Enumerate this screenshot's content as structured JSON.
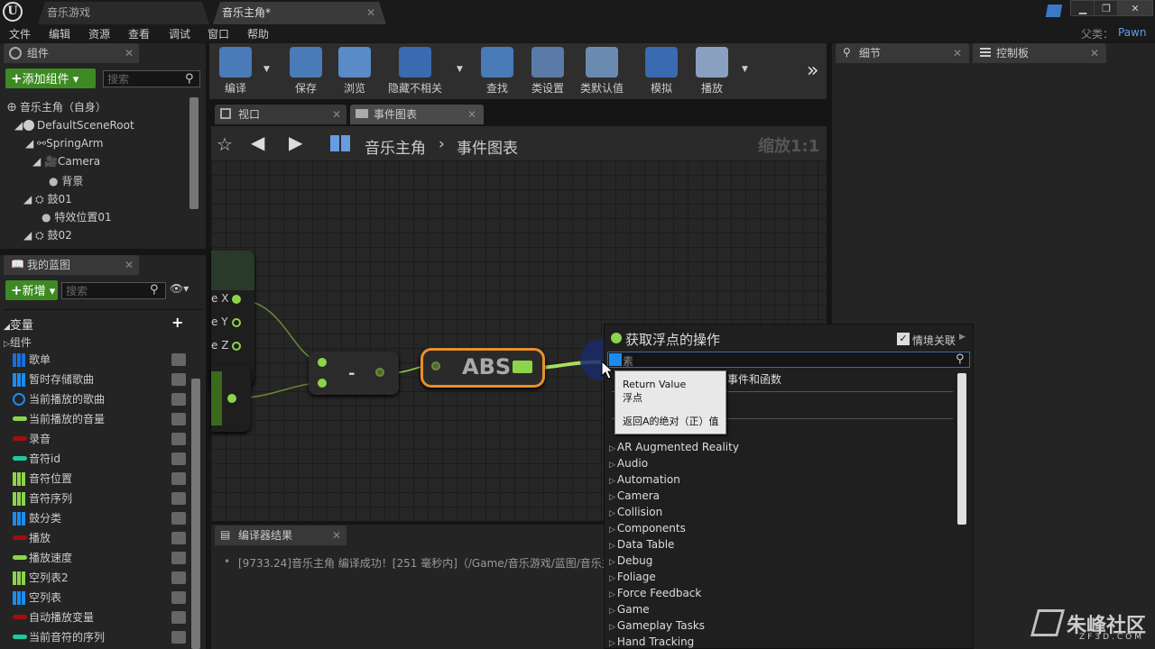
{
  "titlebar": {
    "tabs": [
      {
        "label": "音乐游戏"
      },
      {
        "label": "音乐主角*"
      }
    ],
    "parent_label": "父类：",
    "parent_value": "Pawn"
  },
  "menu": [
    "文件",
    "编辑",
    "资源",
    "查看",
    "调试",
    "窗口",
    "帮助"
  ],
  "components_panel": {
    "tab": "组件",
    "add_button": "添加组件",
    "search_placeholder": "搜索",
    "root": "音乐主角（自身）",
    "tree": [
      "DefaultSceneRoot",
      "SpringArm",
      "Camera",
      "背景",
      "鼓01",
      "特效位置01",
      "鼓02"
    ]
  },
  "blueprint_panel": {
    "tab": "我的蓝图",
    "new_button": "新增",
    "search_placeholder": "搜索",
    "variables_header": "变量",
    "components_header": "组件",
    "variables": [
      {
        "name": "歌单",
        "color": "#1a6fd8",
        "shape": "sq"
      },
      {
        "name": "暂时存储歌曲",
        "color": "#1a8cf0",
        "shape": "sq"
      },
      {
        "name": "当前播放的歌曲",
        "color": "#1a8cf0",
        "shape": "ring"
      },
      {
        "name": "当前播放的音量",
        "color": "#8cd44a",
        "shape": "pill"
      },
      {
        "name": "录音",
        "color": "#a01010",
        "shape": "pill"
      },
      {
        "name": "音符id",
        "color": "#20c8a0",
        "shape": "pill"
      },
      {
        "name": "音符位置",
        "color": "#8cd44a",
        "shape": "sq"
      },
      {
        "name": "音符序列",
        "color": "#8cd44a",
        "shape": "sq"
      },
      {
        "name": "鼓分类",
        "color": "#1a8cf0",
        "shape": "sq"
      },
      {
        "name": "播放",
        "color": "#a01010",
        "shape": "pill"
      },
      {
        "name": "播放速度",
        "color": "#8cd44a",
        "shape": "pill"
      },
      {
        "name": "空列表2",
        "color": "#8cd44a",
        "shape": "sq"
      },
      {
        "name": "空列表",
        "color": "#1a8cf0",
        "shape": "sq"
      },
      {
        "name": "自动播放变量",
        "color": "#a01010",
        "shape": "pill"
      },
      {
        "name": "当前音符的序列",
        "color": "#20c8a0",
        "shape": "pill"
      }
    ]
  },
  "toolbar": [
    {
      "label": "编译",
      "icon": "compile-icon"
    },
    {
      "label": "保存",
      "icon": "save-icon"
    },
    {
      "label": "浏览",
      "icon": "browse-icon"
    },
    {
      "label": "隐藏不相关",
      "icon": "hide-unrelated-icon"
    },
    {
      "label": "查找",
      "icon": "find-icon"
    },
    {
      "label": "类设置",
      "icon": "class-settings-icon"
    },
    {
      "label": "类默认值",
      "icon": "class-defaults-icon"
    },
    {
      "label": "模拟",
      "icon": "simulate-icon"
    },
    {
      "label": "播放",
      "icon": "play-icon"
    }
  ],
  "editor_tabs": [
    "视口",
    "事件图表"
  ],
  "breadcrumb": {
    "root": "音乐主角",
    "sep": "›",
    "current": "事件图表",
    "zoom": "缩放1:1"
  },
  "graph": {
    "pins": [
      "e X",
      "e Y",
      "e Z"
    ],
    "subtract_label": "-",
    "abs_label": "ABS"
  },
  "right_tabs": [
    "细节",
    "控制板"
  ],
  "compiler": {
    "tab": "编译器结果",
    "message": "[9733.24]音乐主角 编译成功！[251 毫秒内]（/Game/音乐游戏/蓝图/音乐主角"
  },
  "context_menu": {
    "title": "获取浮点的操作",
    "context_label": "情境关联",
    "search_text": "素",
    "all_label": "事件和函数",
    "tooltip": {
      "line1": "Return Value",
      "line2": "浮点",
      "line3": "返回A的绝对（正）值"
    },
    "categories": [
      "AR Augmented Reality",
      "Audio",
      "Automation",
      "Camera",
      "Collision",
      "Components",
      "Data Table",
      "Debug",
      "Foliage",
      "Force Feedback",
      "Game",
      "Gameplay Tasks",
      "Hand Tracking"
    ]
  },
  "watermark": {
    "text": "朱峰社区",
    "sub": "ZF3D.COM"
  }
}
